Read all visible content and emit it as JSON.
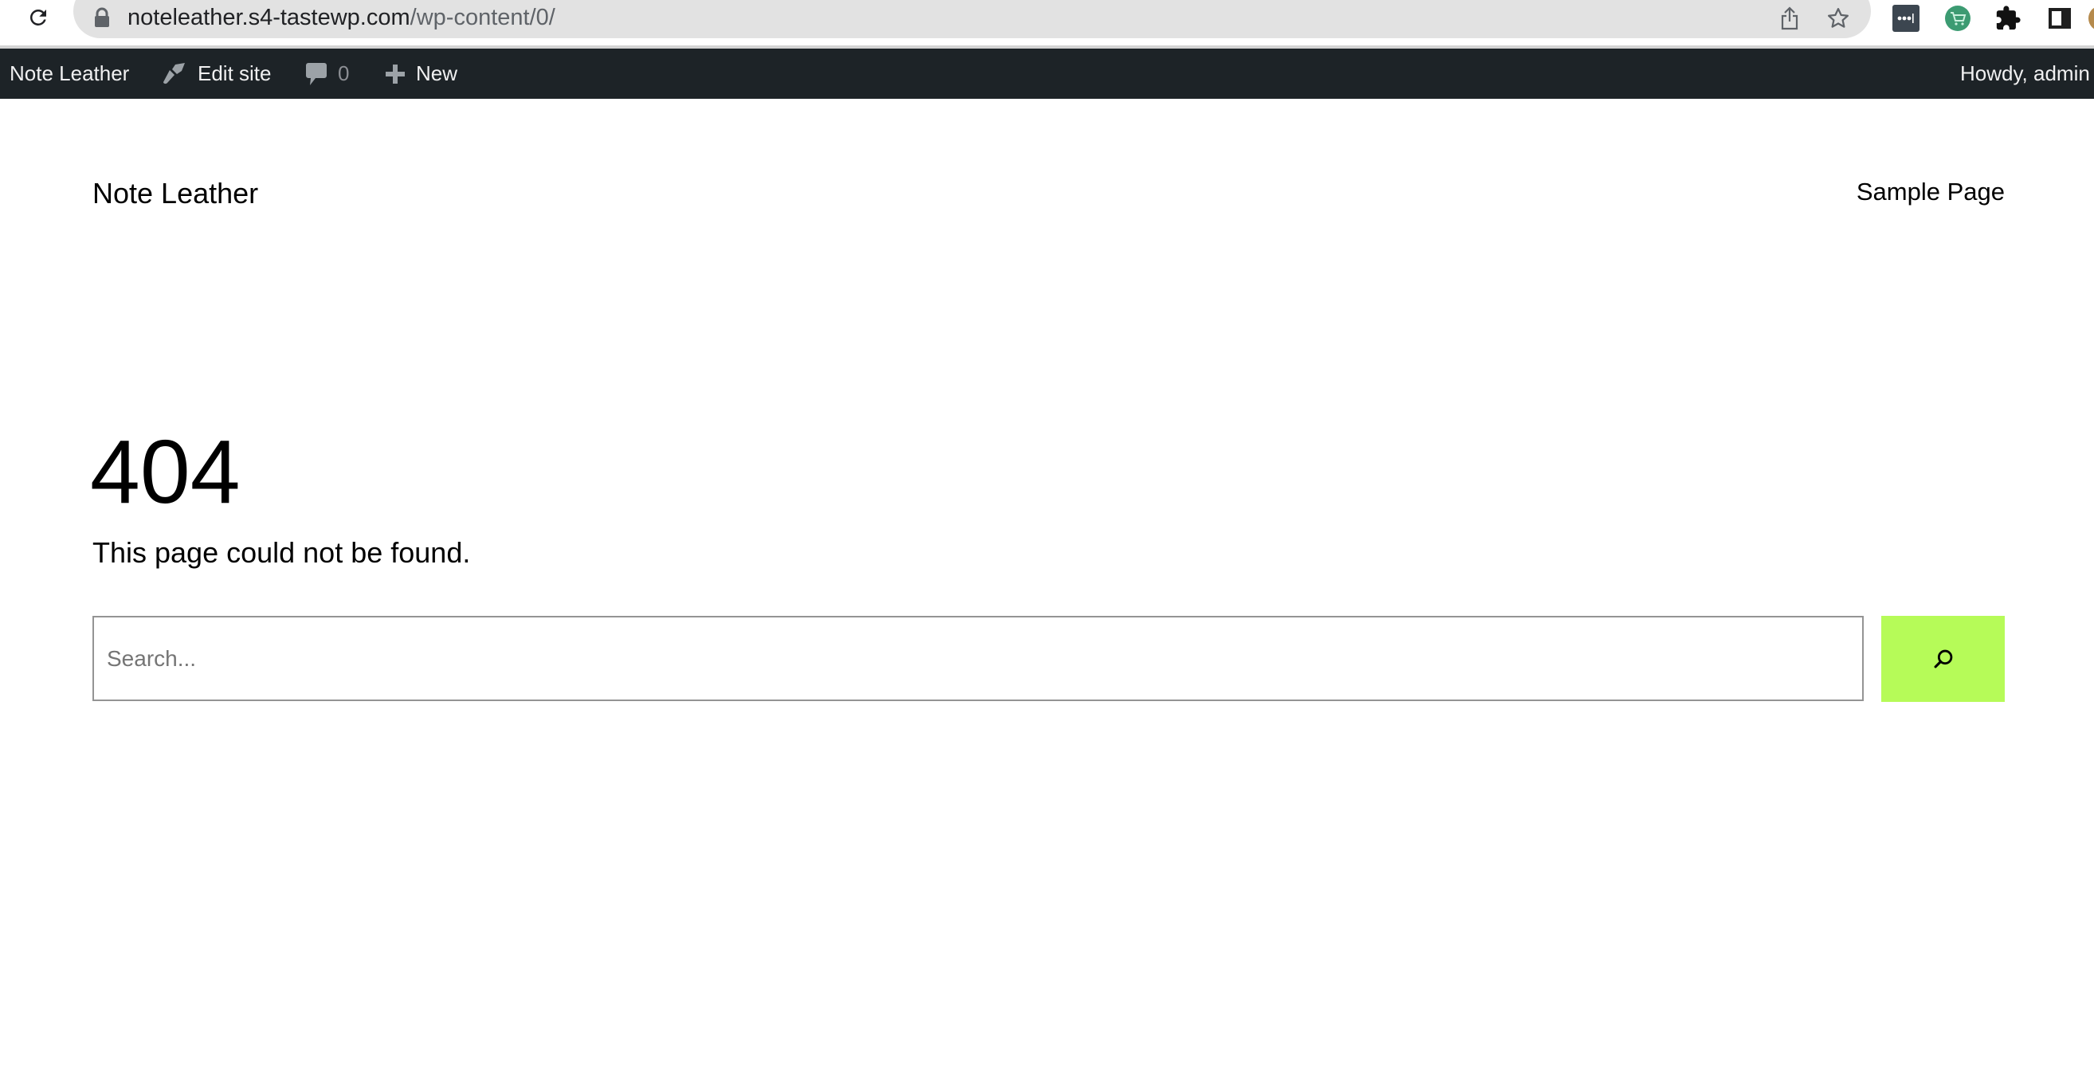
{
  "browser": {
    "url_host": "noteleather.s4-tastewp.com",
    "url_path": "/wp-content/0/",
    "icons": [
      "reload-icon",
      "lock-icon",
      "share-icon",
      "bookmark-star-icon",
      "password-manager-extension-icon",
      "shopping-cart-extension-icon",
      "extensions-puzzle-icon",
      "side-panel-icon",
      "profile-avatar-icon"
    ]
  },
  "admin_bar": {
    "site_name": "Note Leather",
    "edit_site": "Edit site",
    "comments_count": "0",
    "new_label": "New",
    "greeting": "Howdy, admin"
  },
  "header": {
    "site_title": "Note Leather",
    "nav": [
      {
        "label": "Sample Page"
      }
    ]
  },
  "main": {
    "heading": "404",
    "message": "This page could not be found.",
    "search": {
      "value": "",
      "placeholder": "Search...",
      "button_label": "Search",
      "button_color": "#b6fb58"
    }
  }
}
